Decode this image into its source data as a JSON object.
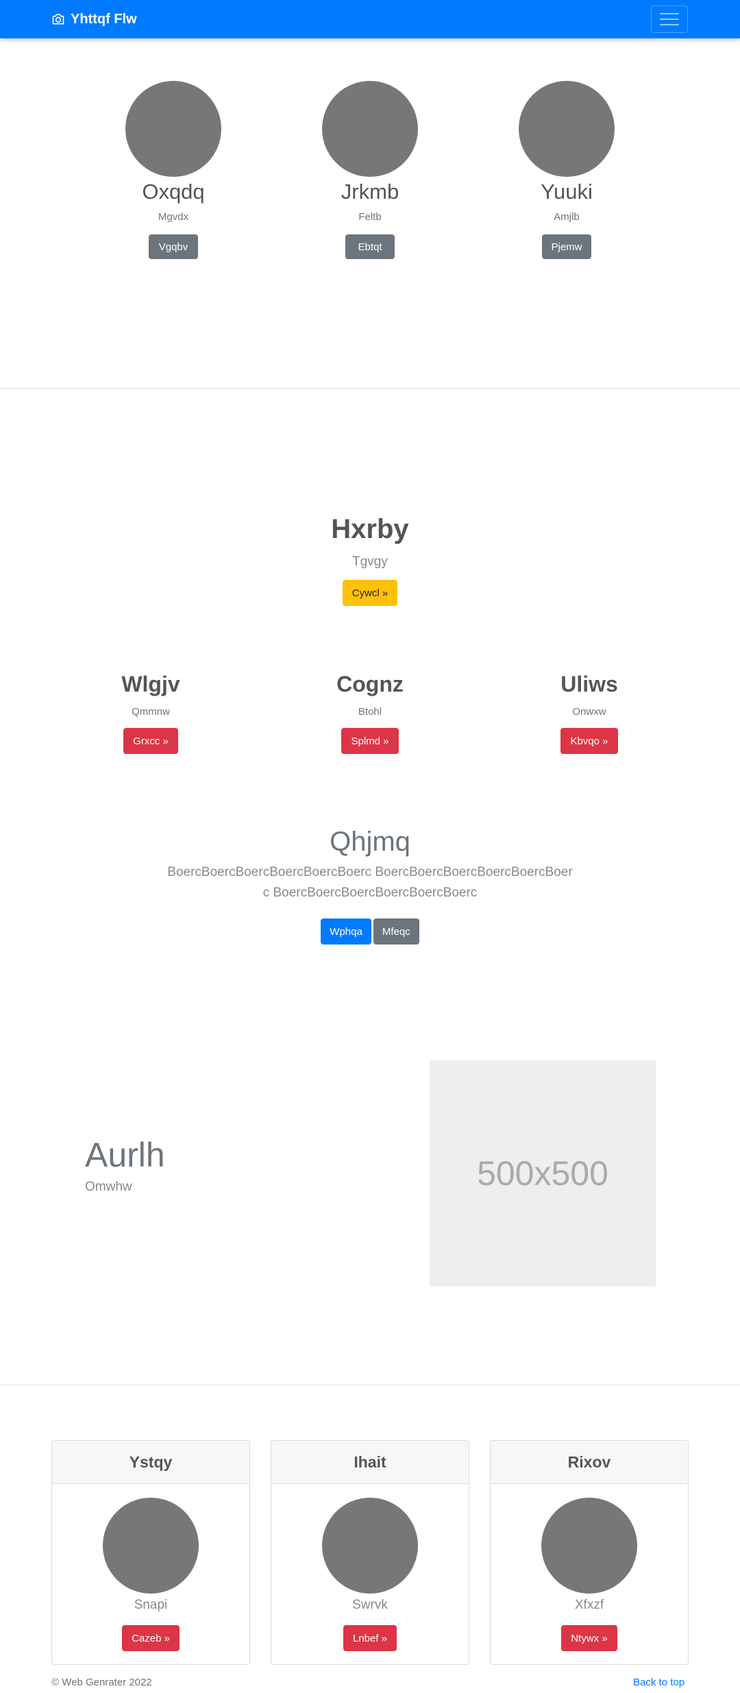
{
  "navbar": {
    "brand": "Yhttqf Flw",
    "brand_icon": "camera-icon",
    "toggler_icon": "hamburger-menu-icon",
    "color": "#007bff"
  },
  "team": [
    {
      "name": "Oxqdq",
      "role": "Mgvdx",
      "button": "Vgqbv"
    },
    {
      "name": "Jrkmb",
      "role": "Feltb",
      "button": "Ebtqt"
    },
    {
      "name": "Yuuki",
      "role": "Amjlb",
      "button": "Pjemw"
    }
  ],
  "hero": {
    "title": "Hxrby",
    "subtitle": "Tgvgy",
    "button": "Cywcl »"
  },
  "columns": [
    {
      "title": "Wlgjv",
      "subtitle": "Qmmnw",
      "button": "Grxcc »"
    },
    {
      "title": "Cognz",
      "subtitle": "Btohl",
      "button": "Splmd »"
    },
    {
      "title": "Uliws",
      "subtitle": "Onwxw",
      "button": "Kbvqo »"
    }
  ],
  "jumbotron": {
    "title": "Qhjmq",
    "lead": "BoercBoercBoercBoercBoercBoerc BoercBoercBoercBoercBoercBoerc BoercBoercBoercBoercBoercBoerc",
    "primary_button": "Wphqa",
    "secondary_button": "Mfeqc"
  },
  "feature": {
    "title": "Aurlh",
    "subtitle": "Omwhw",
    "image_label": "500x500"
  },
  "cards": [
    {
      "header": "Ystqy",
      "subtitle": "Snapi",
      "button": "Cazeb »"
    },
    {
      "header": "Ihait",
      "subtitle": "Swrvk",
      "button": "Lnbef »"
    },
    {
      "header": "Rixov",
      "subtitle": "Xfxzf",
      "button": "Ntywx »"
    }
  ],
  "footer": {
    "copyright": "© Web Genrater 2022",
    "back_to_top": "Back to top"
  }
}
